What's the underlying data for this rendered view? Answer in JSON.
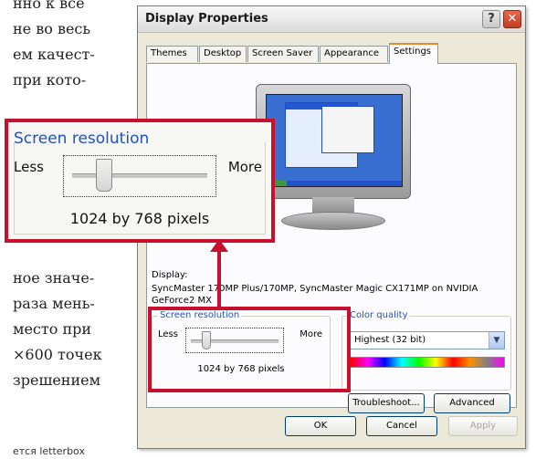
{
  "background_text": {
    "lines": [
      "нно к все",
      "не во весь",
      "ем качест-",
      "при кото-",
      "ное значе-",
      "раза мень-",
      "место при",
      "×600 точек",
      "зрешением",
      "ется letterbox"
    ]
  },
  "dialog": {
    "title": "Display Properties",
    "help_icon": "help-icon",
    "close_icon": "close-icon",
    "tabs": [
      "Themes",
      "Desktop",
      "Screen Saver",
      "Appearance",
      "Settings"
    ],
    "active_tab": "Settings",
    "display_label": "Display:",
    "display_value": "SyncMaster 170MP Plus/170MP, SyncMaster Magic CX171MP on NVIDIA GeForce2 MX",
    "screen_resolution": {
      "legend": "Screen resolution",
      "less": "Less",
      "more": "More",
      "value": "1024 by 768 pixels"
    },
    "color_quality": {
      "legend": "Color quality",
      "selected": "Highest (32 bit)"
    },
    "buttons": {
      "troubleshoot": "Troubleshoot...",
      "advanced": "Advanced",
      "ok": "OK",
      "cancel": "Cancel",
      "apply": "Apply"
    }
  },
  "callout": {
    "legend": "Screen resolution",
    "less": "Less",
    "more": "More",
    "value": "1024 by 768 pixels"
  },
  "colors": {
    "highlight": "#c8102e",
    "legend_blue": "#1f4fcf",
    "dialog_bg": "#ece9d8"
  }
}
